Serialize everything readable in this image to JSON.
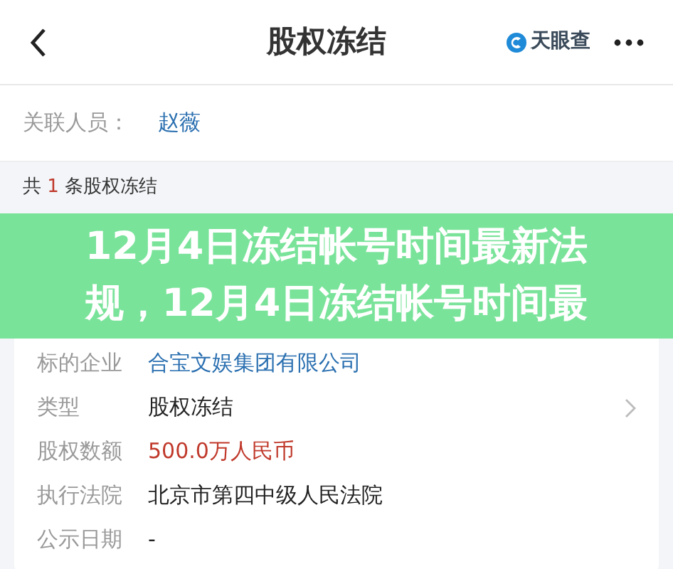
{
  "header": {
    "title": "股权冻结",
    "brand": "天眼查"
  },
  "related": {
    "label": "关联人员：",
    "value": "赵薇"
  },
  "summary": {
    "prefix": "共",
    "count": "1",
    "suffix": "条股权冻结"
  },
  "record": [
    {
      "label": "标的企业",
      "value": "合宝文娱集团有限公司",
      "kind": "link"
    },
    {
      "label": "类型",
      "value": "股权冻结",
      "kind": "expandable"
    },
    {
      "label": "股权数额",
      "value": "500.0万人民币",
      "kind": "amount"
    },
    {
      "label": "执行法院",
      "value": "北京市第四中级人民法院",
      "kind": "plain"
    },
    {
      "label": "公示日期",
      "value": "-",
      "kind": "plain"
    }
  ],
  "banner": {
    "title": "12月4日冻结帐号时间最新法规，12月4日冻结帐号时间最"
  }
}
